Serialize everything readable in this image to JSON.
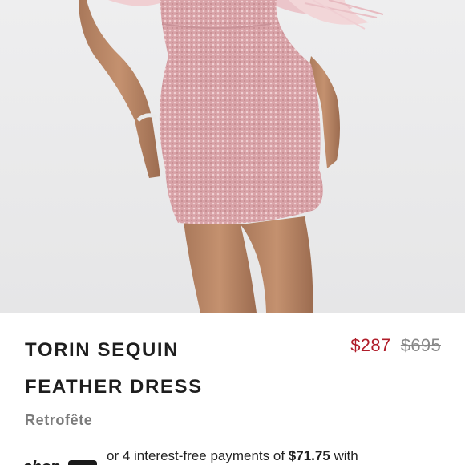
{
  "product": {
    "title_line1": "TORIN SEQUIN",
    "title_line2": "FEATHER DRESS",
    "price_sale": "$287",
    "price_original": "$695",
    "brand": "Retrofête",
    "installments_prefix": "or 4 interest-free payments of ",
    "installments_amount": "$71.75",
    "installments_suffix": " with",
    "payment_logo": "shop-pay-logo"
  },
  "colors": {
    "sale_price": "#b01d2a",
    "original_price": "#888888",
    "dress": "#d9a3a8",
    "background": "#ececed"
  }
}
